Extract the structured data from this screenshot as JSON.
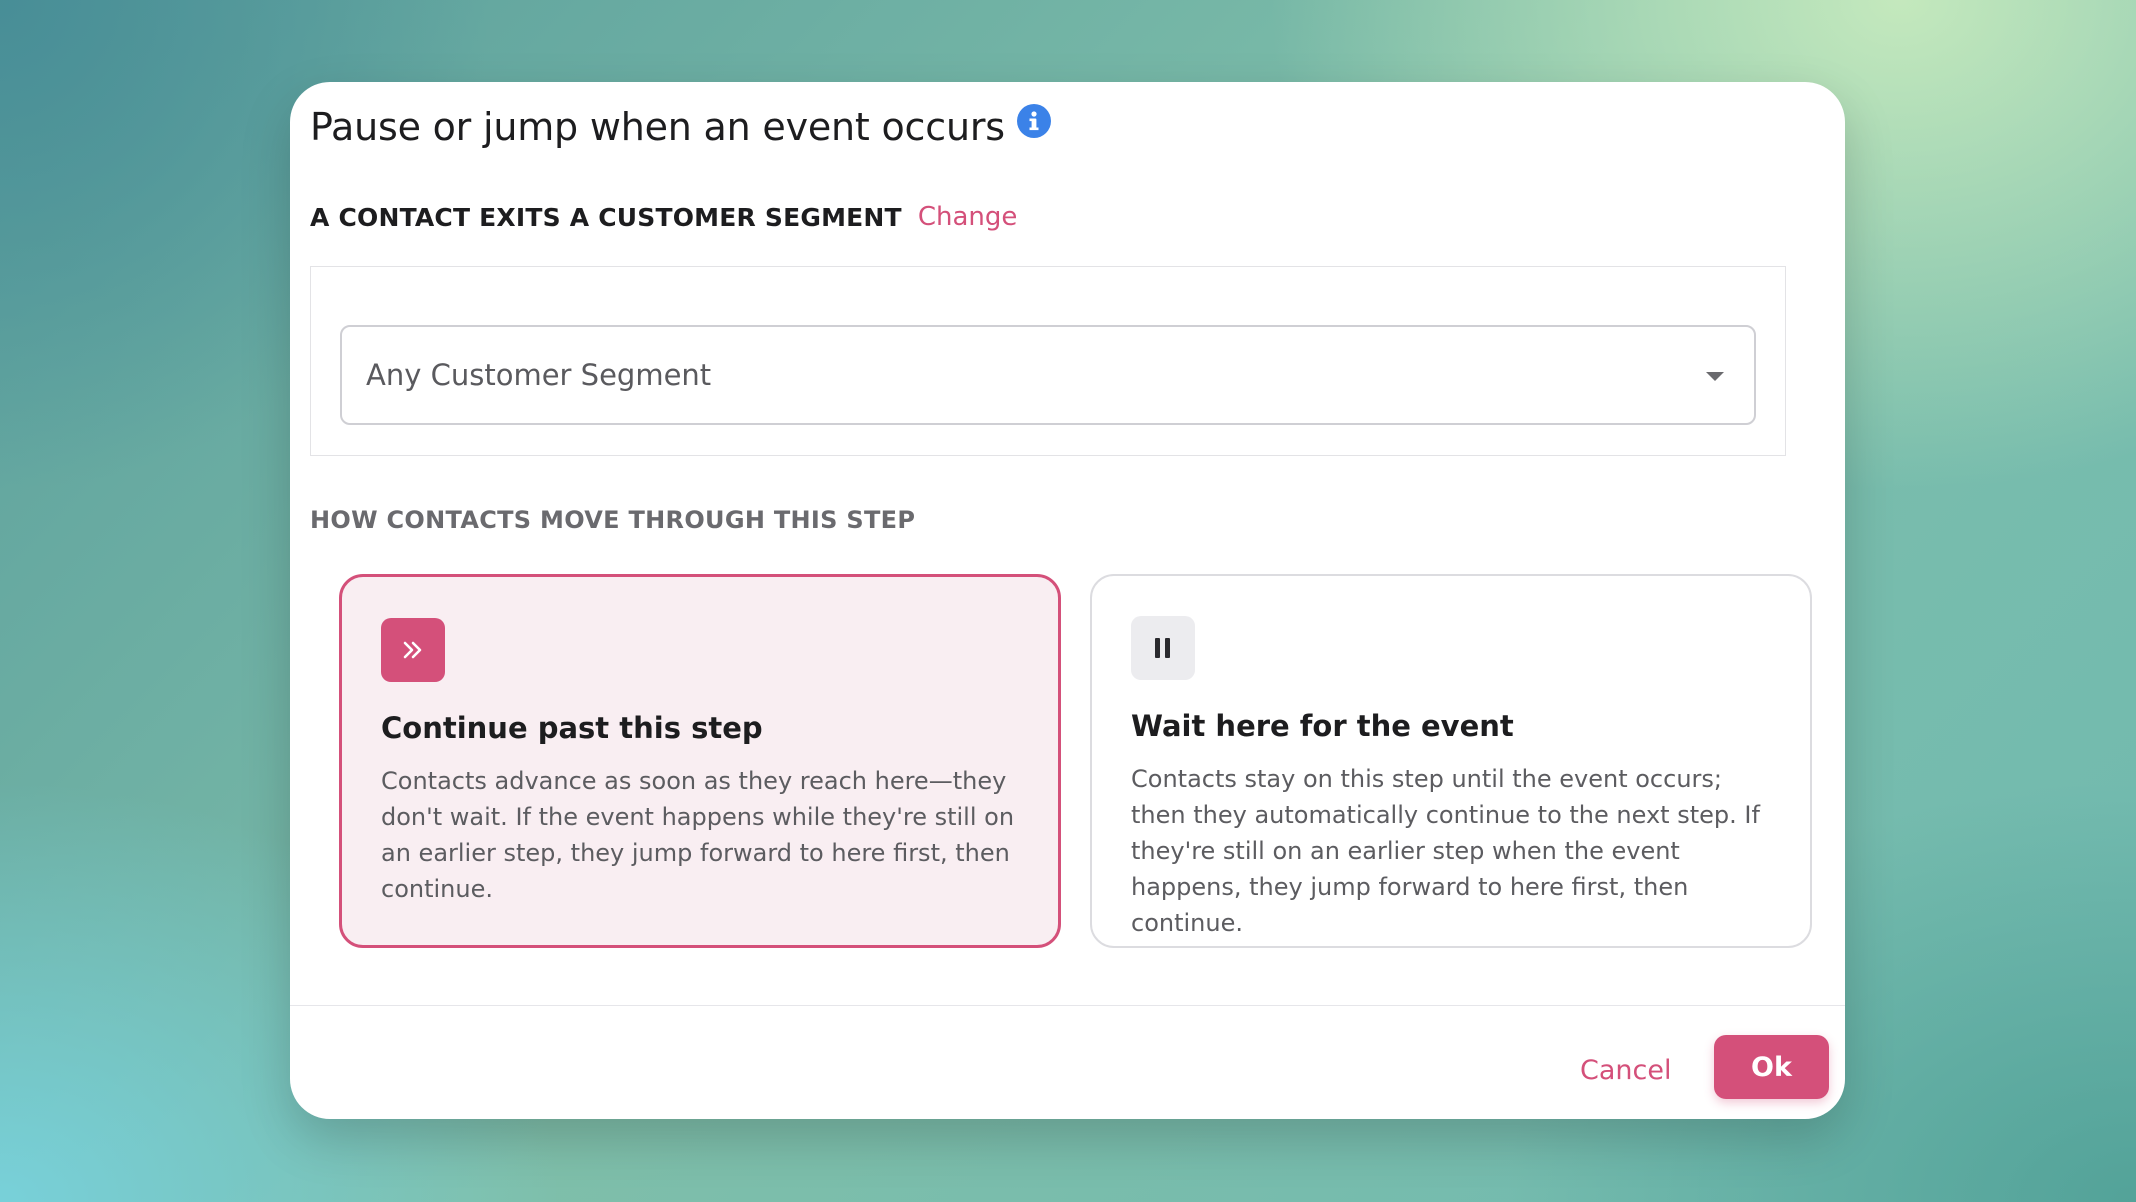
{
  "dialog": {
    "title": "Pause or jump when an event occurs",
    "info_icon": "info-icon"
  },
  "trigger": {
    "label": "A CONTACT EXITS A CUSTOMER SEGMENT",
    "change_label": "Change"
  },
  "segment_select": {
    "value": "Any Customer Segment",
    "icon": "caret-down-icon"
  },
  "movement": {
    "section_label": "HOW CONTACTS MOVE THROUGH THIS STEP",
    "options": [
      {
        "title": "Continue past this step",
        "description": "Contacts advance as soon as they reach here—they don't wait. If the event happens while they're still on an earlier step, they jump forward to here first, then continue.",
        "icon": "double-chevron-right-icon",
        "selected": true
      },
      {
        "title": "Wait here for the event",
        "description": "Contacts stay on this step until the event occurs; then they automatically continue to the next step. If they're still on an earlier step when the event happens, they jump forward to here first, then continue.",
        "icon": "pause-icon",
        "selected": false
      }
    ]
  },
  "footer": {
    "cancel_label": "Cancel",
    "ok_label": "Ok"
  },
  "colors": {
    "accent": "#d4507a",
    "selected_card_bg": "#f9eef2",
    "info_blue": "#3b82e8"
  }
}
